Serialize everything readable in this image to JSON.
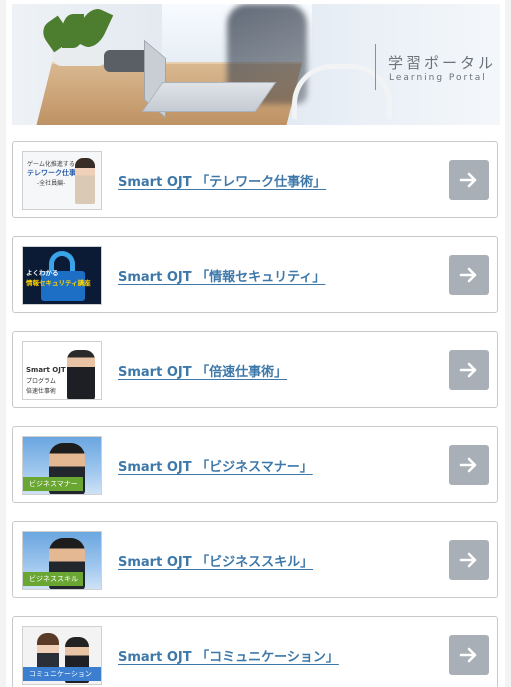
{
  "banner": {
    "title_jp": "学習ポータル",
    "title_en": "Learning Portal"
  },
  "courses": [
    {
      "title": "Smart OJT 「テレワーク仕事術」",
      "thumb_lines": [
        "ゲーム化推進する",
        "テレワーク仕事術",
        "-全社員編-"
      ]
    },
    {
      "title": "Smart OJT 「情報セキュリティ」",
      "thumb_lines": [
        "よくわかる",
        "情報セキュリティ講座"
      ]
    },
    {
      "title": "Smart OJT 「倍速仕事術」",
      "thumb_lines": [
        "Smart OJT",
        "プログラム",
        "倍速仕事術"
      ]
    },
    {
      "title": "Smart OJT 「ビジネスマナー」",
      "thumb_lines": [
        "ビジネスマナー"
      ]
    },
    {
      "title": "Smart OJT 「ビジネススキル」",
      "thumb_lines": [
        "ビジネススキル"
      ]
    },
    {
      "title": "Smart OJT 「コミュニケーション」",
      "thumb_lines": [
        "コミュニケーション"
      ]
    }
  ],
  "colors": {
    "link": "#3e78a9",
    "arrow_button": "#a9afb6",
    "green_label": "#6aa632",
    "blue_label": "#3c7fd0"
  },
  "icons": {
    "arrow": "arrow-right-icon"
  }
}
